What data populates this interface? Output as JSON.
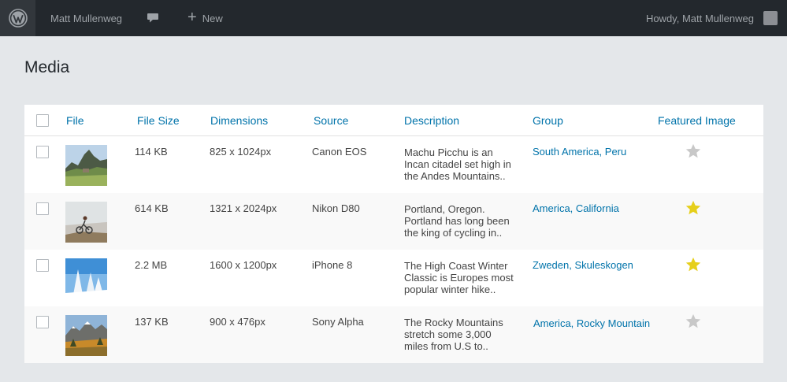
{
  "adminbar": {
    "site_name": "Matt Mullenweg",
    "new_label": "New",
    "howdy_label": "Howdy,",
    "user_name": "Matt Mullenweg",
    "icons": [
      "wordpress-icon",
      "comment-icon",
      "plus-icon",
      "avatar"
    ]
  },
  "page": {
    "title": "Media"
  },
  "table": {
    "columns": [
      "File",
      "File Size",
      "Dimensions",
      "Source",
      "Description",
      "Group",
      "Featured Image"
    ],
    "rows": [
      {
        "size": "114 KB",
        "dimensions": "825 x 1024px",
        "source": "Canon EOS",
        "description": [
          "Machu Picchu is an",
          "Incan citadel set high in",
          "the Andes Mountains.."
        ],
        "group": "South America, Peru",
        "featured": false
      },
      {
        "size": "614 KB",
        "dimensions": "1321 x 2024px",
        "source": "Nikon D80",
        "description": [
          "Portland, Oregon.",
          "Portland has long been",
          "the king of cycling in.."
        ],
        "group": "America, California",
        "featured": true
      },
      {
        "size": "2.2 MB",
        "dimensions": "1600 x 1200px",
        "source": "iPhone 8",
        "description": [
          "The High Coast Winter",
          "Classic is Europes most",
          "popular winter hike.."
        ],
        "group": "Zweden, Skuleskogen",
        "featured": true
      },
      {
        "size": "137 KB",
        "dimensions": "900 x 476px",
        "source": "Sony Alpha",
        "description": [
          "The Rocky Mountains",
          "stretch some 3,000",
          "miles from U.S to.."
        ],
        "group": "America, Rocky Mountain",
        "featured": false
      }
    ]
  },
  "colors": {
    "accent": "#0073aa",
    "star_on": "#e6cf1b",
    "star_off": "#c8c8c8",
    "adminbar_bg": "#23282d"
  }
}
